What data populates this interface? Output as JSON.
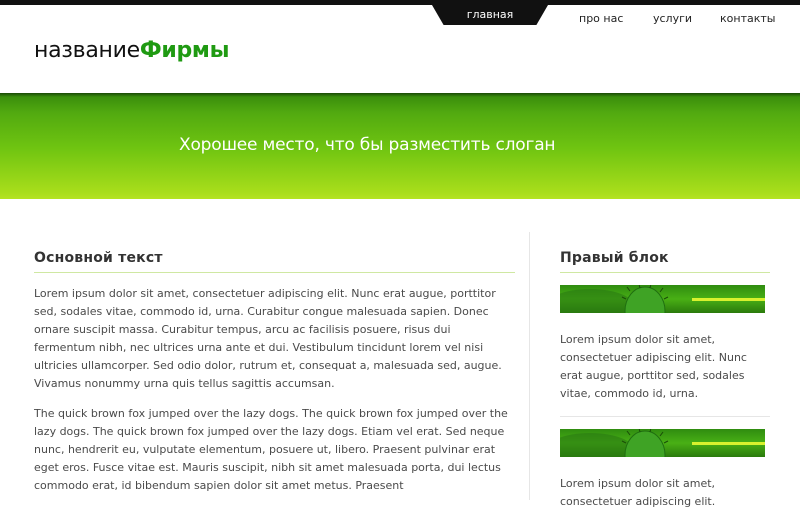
{
  "nav": {
    "active": "главная",
    "items": [
      "про нас",
      "услуги",
      "контакты"
    ]
  },
  "logo": {
    "part1": "название",
    "part2": "Фирмы"
  },
  "banner": {
    "slogan": "Хорошее место, что бы разместить слоган"
  },
  "main": {
    "title": "Основной текст",
    "paragraphs": [
      "Lorem ipsum dolor sit amet, consectetuer adipiscing elit. Nunc erat augue, porttitor sed, sodales vitae, commodo id, urna. Curabitur congue malesuada sapien. Donec ornare suscipit massa. Curabitur tempus, arcu ac facilisis posuere, risus dui fermentum nibh, nec ultrices urna ante et dui. Vestibulum tincidunt lorem vel nisi ultricies ullamcorper. Sed odio dolor, rutrum et, consequat a, malesuada sed, augue. Vivamus nonummy urna quis tellus sagittis accumsan.",
      "The quick brown fox jumped over the lazy dogs. The quick brown fox jumped over the lazy dogs. The quick brown fox jumped over the lazy dogs. Etiam vel erat. Sed neque nunc, hendrerit eu, vulputate elementum, posuere ut, libero. Praesent pulvinar erat eget eros. Fusce vitae est. Mauris suscipit, nibh sit amet malesuada porta, dui lectus commodo erat, id bibendum sapien dolor sit amet metus. Praesent"
    ]
  },
  "sidebar": {
    "title": "Правый блок",
    "blocks": [
      {
        "text": "Lorem ipsum dolor sit amet, consectetuer adipiscing elit. Nunc erat augue, porttitor sed, sodales vitae, commodo id, urna."
      },
      {
        "text": "Lorem ipsum dolor sit amet, consectetuer adipiscing elit."
      }
    ]
  },
  "colors": {
    "accent": "#1f9a12",
    "banner_top": "#3b8f0c",
    "banner_bottom": "#b5e321",
    "nav_bg": "#111111"
  }
}
